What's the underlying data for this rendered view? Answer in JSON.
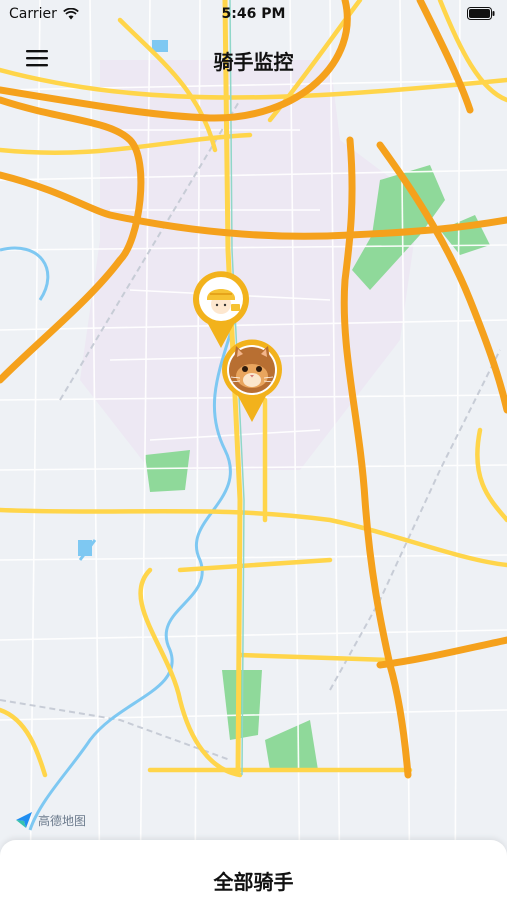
{
  "status_bar": {
    "carrier": "Carrier",
    "time": "5:46 PM"
  },
  "nav": {
    "title": "骑手监控"
  },
  "map": {
    "provider_logo_text": "高德地图"
  },
  "markers": [
    {
      "name": "rider-marker-delivery",
      "avatar": "delivery-rider-avatar"
    },
    {
      "name": "rider-marker-cat",
      "avatar": "cat-avatar"
    }
  ],
  "bottom_sheet": {
    "title": "全部骑手"
  },
  "colors": {
    "map_background": "#eef1f5",
    "expressway": "#f5a11c",
    "arterial": "#ffd54a",
    "marker_ring": "#f2b21c",
    "water": "#7ec8f2",
    "park": "#8fd99a"
  }
}
